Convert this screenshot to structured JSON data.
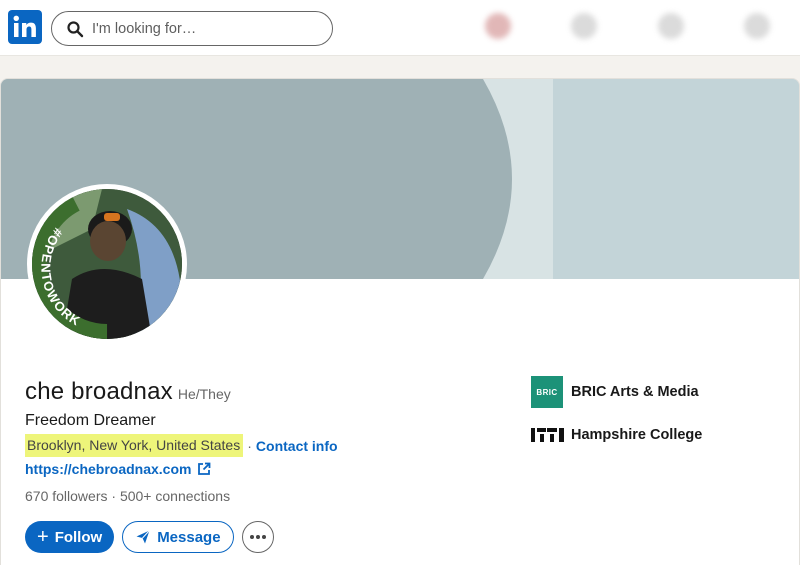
{
  "nav": {
    "search_placeholder": "I'm looking for…"
  },
  "profile": {
    "name": "che broadnax",
    "pronouns": "He/They",
    "headline": "Freedom Dreamer",
    "location": "Brooklyn, New York, United States",
    "separator": "·",
    "contact_label": "Contact info",
    "website": "https://chebroadnax.com",
    "followers": "670 followers",
    "connections_sep": "·",
    "connections": "500+ connections",
    "avatar_frame_text": "#OPENTOWORK"
  },
  "actions": {
    "follow_label": "Follow",
    "follow_icon": "plus-icon",
    "message_label": "Message",
    "message_icon": "send-icon",
    "more_icon": "ellipsis-icon"
  },
  "organizations": [
    {
      "name": "BRIC Arts & Media",
      "logo_text": "BRIC",
      "logo_color": "#1c9278"
    },
    {
      "name": "Hampshire College",
      "logo_icon": "hampshire-logo"
    }
  ],
  "colors": {
    "brand": "#0a66c2",
    "highlight": "#eef57a",
    "open_to_work": "#3c6e2e"
  }
}
